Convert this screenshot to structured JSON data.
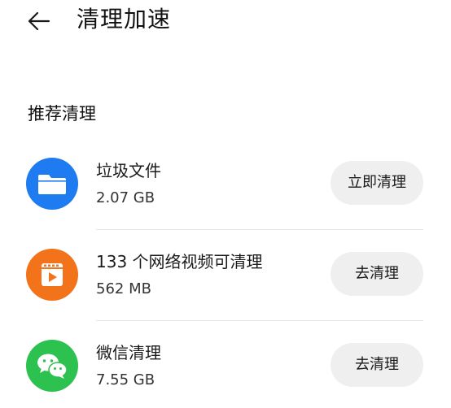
{
  "header": {
    "title": "清理加速",
    "back_icon": "arrow-left-icon"
  },
  "section": {
    "title": "推荐清理"
  },
  "items": [
    {
      "name": "垃圾文件",
      "size": "2.07 GB",
      "button": "立即清理",
      "icon": "folder-icon",
      "icon_color": "#1E7BF0"
    },
    {
      "name": "133 个网络视频可清理",
      "size": "562 MB",
      "button": "去清理",
      "icon": "video-clapper-icon",
      "icon_color": "#F2731A"
    },
    {
      "name": "微信清理",
      "size": "7.55 GB",
      "button": "去清理",
      "icon": "wechat-icon",
      "icon_color": "#2DC150"
    }
  ],
  "colors": {
    "button_bg": "#EFEFEF",
    "divider": "#E6E6E6",
    "text": "#1A1A1A"
  }
}
